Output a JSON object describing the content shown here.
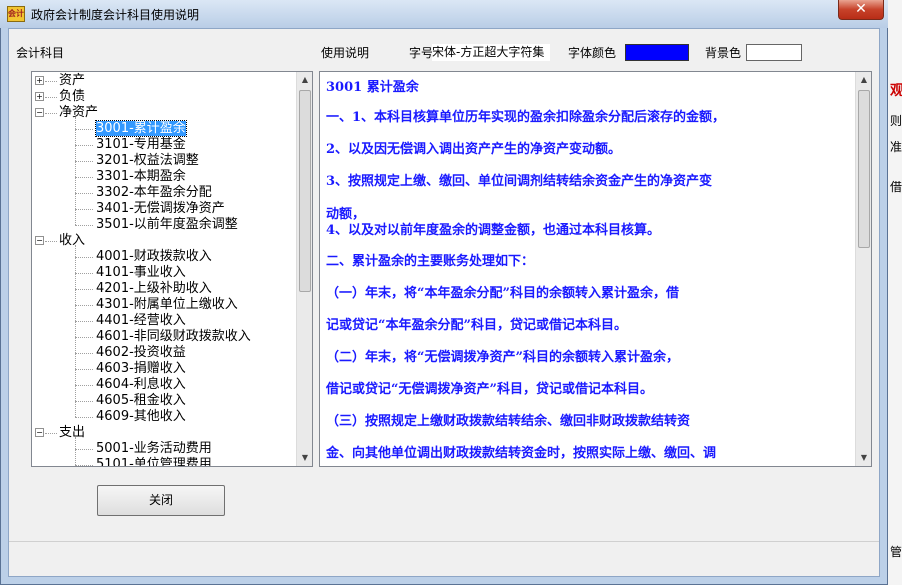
{
  "window": {
    "title": "政府会计制度会计科目使用说明",
    "app_icon_text": "会计",
    "close_glyph": "✕"
  },
  "labels": {
    "subjects": "会计科目",
    "usage": "使用说明",
    "font": "字号",
    "font_value": "宋体-方正超大字符集",
    "font_color": "字体颜色",
    "bg_color": "背景色",
    "font_color_hex": "#0000ff",
    "bg_color_hex": "#ffffff"
  },
  "tree": [
    {
      "label": "资产",
      "level": 0,
      "expander": "+"
    },
    {
      "label": "负债",
      "level": 0,
      "expander": "+"
    },
    {
      "label": "净资产",
      "level": 0,
      "expander": "−"
    },
    {
      "label": "3001-累计盈余",
      "level": 1,
      "selected": true
    },
    {
      "label": "3101-专用基金",
      "level": 1
    },
    {
      "label": "3201-权益法调整",
      "level": 1
    },
    {
      "label": "3301-本期盈余",
      "level": 1
    },
    {
      "label": "3302-本年盈余分配",
      "level": 1
    },
    {
      "label": "3401-无偿调拨净资产",
      "level": 1
    },
    {
      "label": "3501-以前年度盈余调整",
      "level": 1
    },
    {
      "label": "收入",
      "level": 0,
      "expander": "−"
    },
    {
      "label": "4001-财政拨款收入",
      "level": 1
    },
    {
      "label": "4101-事业收入",
      "level": 1
    },
    {
      "label": "4201-上级补助收入",
      "level": 1
    },
    {
      "label": "4301-附属单位上缴收入",
      "level": 1
    },
    {
      "label": "4401-经营收入",
      "level": 1
    },
    {
      "label": "4601-非同级财政拨款收入",
      "level": 1
    },
    {
      "label": "4602-投资收益",
      "level": 1
    },
    {
      "label": "4603-捐赠收入",
      "level": 1
    },
    {
      "label": "4604-利息收入",
      "level": 1
    },
    {
      "label": "4605-租金收入",
      "level": 1
    },
    {
      "label": "4609-其他收入",
      "level": 1
    },
    {
      "label": "支出",
      "level": 0,
      "expander": "−"
    },
    {
      "label": "5001-业务活动费用",
      "level": 1
    },
    {
      "label": "5101-单位管理费用",
      "level": 1
    }
  ],
  "document": [
    "3001 累计盈余",
    "一、1、本科目核算单位历年实现的盈余扣除盈余分配后滚存的金额，",
    "    2、以及因无偿调入调出资产产生的净资产变动额。",
    "    3、按照规定上缴、缴回、单位间调剂结转结余资金产生的净资产变",
    "动额，",
    "    4、以及对以前年度盈余的调整金额，也通过本科目核算。",
    "二、累计盈余的主要账务处理如下：",
    "（一）年末，将“本年盈余分配”科目的余额转入累计盈余，借",
    "记或贷记“本年盈余分配”科目，贷记或借记本科目。",
    "（二）年末，将“无偿调拨净资产”科目的余额转入累计盈余，",
    "借记或贷记“无偿调拨净资产”科目，贷记或借记本科目。",
    "（三）按照规定上缴财政拨款结转结余、缴回非财政拨款结转资",
    "金、向其他单位调出财政拨款结转资金时，按照实际上缴、缴回、调"
  ],
  "buttons": {
    "close": "关闭"
  },
  "right_strip": [
    "观",
    "则",
    "准",
    "借",
    "管"
  ]
}
